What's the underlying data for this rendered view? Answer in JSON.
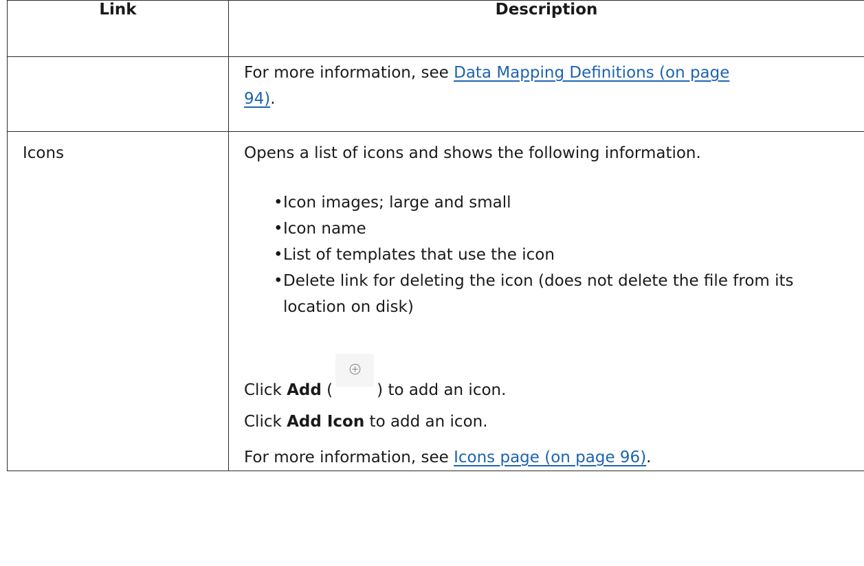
{
  "table": {
    "headers": {
      "link": "Link",
      "description": "Description"
    },
    "continued_row": {
      "desc_prefix": "For more information, see ",
      "link_text_1": "Data Mapping Definitions (on page",
      "link_text_2": "94)",
      "desc_suffix": "."
    },
    "icons_row": {
      "link": "Icons",
      "intro": "Opens a list of icons and shows the following information.",
      "bullets": [
        "Icon images; large and small",
        "Icon name",
        "List of templates that use the icon",
        "Delete link for deleting the icon (does not delete the file from its location on disk)"
      ],
      "add_click": "Click ",
      "add_bold": "Add",
      "add_open_paren": " (",
      "add_close_rest": ") to add an icon.",
      "add_icon_click": "Click ",
      "add_icon_bold": "Add Icon",
      "add_icon_rest": " to add an icon.",
      "more_prefix": "For more information, see ",
      "more_link": "Icons page (on page 96)",
      "more_suffix": "."
    }
  },
  "icons": {
    "add": "plus-circle-icon"
  },
  "colors": {
    "link": "#1d63b0",
    "border": "#2a2a2a",
    "icon_bg": "#f5f5f5"
  }
}
